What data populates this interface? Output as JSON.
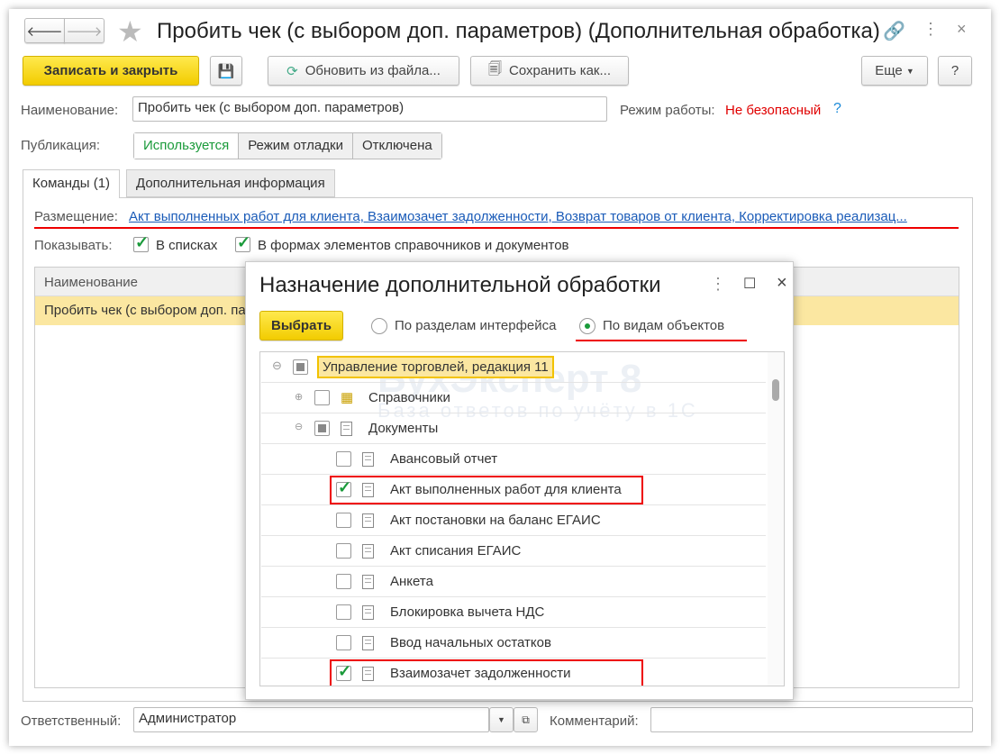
{
  "window": {
    "title": "Пробить чек (с выбором доп. параметров) (Дополнительная обработка)"
  },
  "toolbar": {
    "save_close": "Записать и закрыть",
    "update_from_file": "Обновить из файла...",
    "save_as": "Сохранить как...",
    "more": "Еще",
    "help": "?"
  },
  "form": {
    "name_label": "Наименование:",
    "name_value": "Пробить чек (с выбором доп. параметров)",
    "mode_label": "Режим работы:",
    "mode_value": "Не безопасный",
    "mode_help": "?",
    "publication_label": "Публикация:",
    "publication_options": [
      "Используется",
      "Режим отладки",
      "Отключена"
    ],
    "publication_selected": "Используется"
  },
  "tabs": [
    {
      "label": "Команды (1)",
      "active": true
    },
    {
      "label": "Дополнительная информация",
      "active": false
    }
  ],
  "commands": {
    "placement_label": "Размещение:",
    "placement_value": "Акт выполненных работ для клиента, Взаимозачет задолженности, Возврат товаров от клиента, Корректировка реализац...",
    "show_label": "Показывать:",
    "show_in_lists": "В списках",
    "show_in_forms": "В формах элементов справочников и документов",
    "table_header": "Наименование",
    "table_row": "Пробить чек (с выбором доп. параметров)"
  },
  "footer": {
    "responsible_label": "Ответственный:",
    "responsible_value": "Администратор",
    "comment_label": "Комментарий:",
    "comment_value": ""
  },
  "dialog": {
    "title": "Назначение дополнительной обработки",
    "select": "Выбрать",
    "radio_sections": "По разделам интерфейса",
    "radio_objects": "По видам объектов",
    "radio_selected": "По видам объектов",
    "tree": {
      "root": "Управление торговлей, редакция 11",
      "catalogs": "Справочники",
      "documents": "Документы",
      "items": [
        {
          "label": "Авансовый отчет",
          "checked": false
        },
        {
          "label": "Акт выполненных работ для клиента",
          "checked": true
        },
        {
          "label": "Акт постановки на баланс ЕГАИС",
          "checked": false
        },
        {
          "label": "Акт списания ЕГАИС",
          "checked": false
        },
        {
          "label": "Анкета",
          "checked": false
        },
        {
          "label": "Блокировка вычета НДС",
          "checked": false
        },
        {
          "label": "Ввод начальных остатков",
          "checked": false
        },
        {
          "label": "Взаимозачет задолженности",
          "checked": true
        }
      ]
    }
  },
  "watermark": {
    "brand": "БухЭксперт 8",
    "tagline": "База ответов по учёту в 1С"
  },
  "colors": {
    "accent_yellow": "#f2cc00",
    "link": "#1a5bb8",
    "danger": "#e00000",
    "active_green": "#1a9a3a",
    "highlight_row": "#fbe7a1"
  }
}
